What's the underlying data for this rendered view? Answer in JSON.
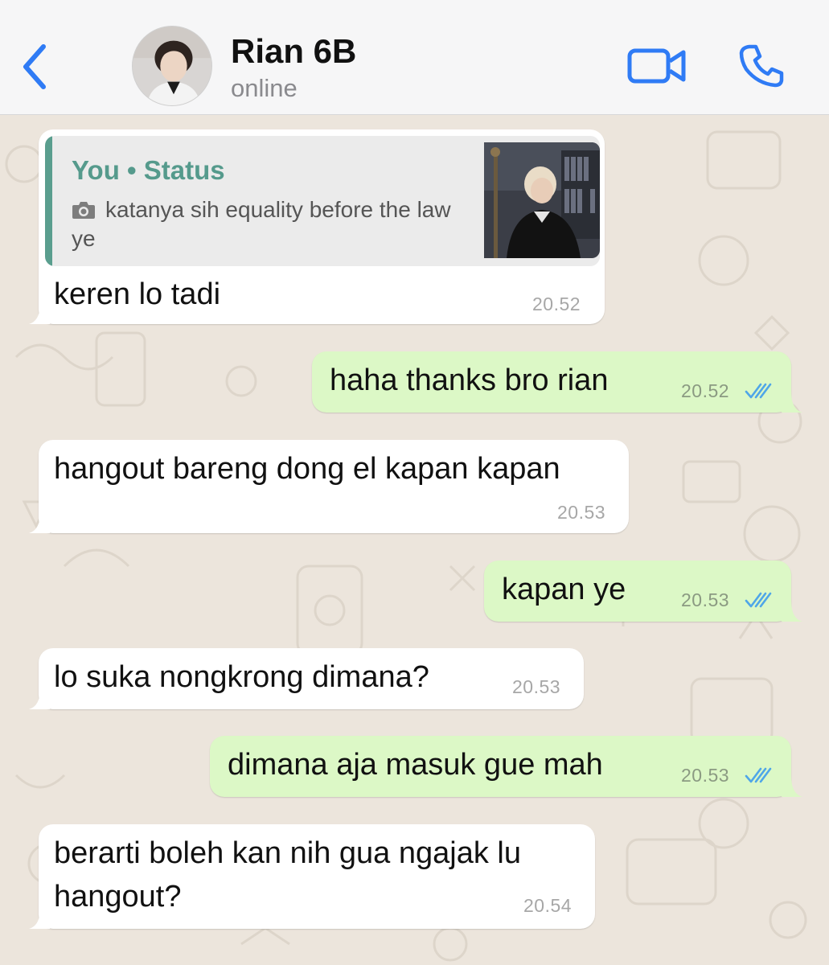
{
  "header": {
    "contact_name": "Rian 6B",
    "contact_status": "online",
    "accent_color": "#2f7bf5"
  },
  "chat": {
    "messages": [
      {
        "direction": "incoming",
        "quote": {
          "title": "You • Status",
          "text": "katanya sih equality before the law ye",
          "icon": "camera-icon"
        },
        "text": "keren lo tadi",
        "time": "20.52"
      },
      {
        "direction": "outgoing",
        "text": "haha thanks bro rian",
        "time": "20.52",
        "read": true
      },
      {
        "direction": "incoming",
        "text": "hangout bareng dong el kapan kapan",
        "time": "20.53"
      },
      {
        "direction": "outgoing",
        "text": "kapan ye",
        "time": "20.53",
        "read": true
      },
      {
        "direction": "incoming",
        "text": "lo suka nongkrong dimana?",
        "time": "20.53"
      },
      {
        "direction": "outgoing",
        "text": "dimana aja masuk gue mah",
        "time": "20.53",
        "read": true
      },
      {
        "direction": "incoming",
        "text": "berarti boleh kan nih gua ngajak lu\nhangout?",
        "time": "20.54"
      }
    ]
  },
  "colors": {
    "incoming_bubble": "#ffffff",
    "outgoing_bubble": "#dcf8c6",
    "read_ticks": "#4fa6e8",
    "quote_accent": "#5a9e8e",
    "wallpaper": "#ece5dc"
  }
}
